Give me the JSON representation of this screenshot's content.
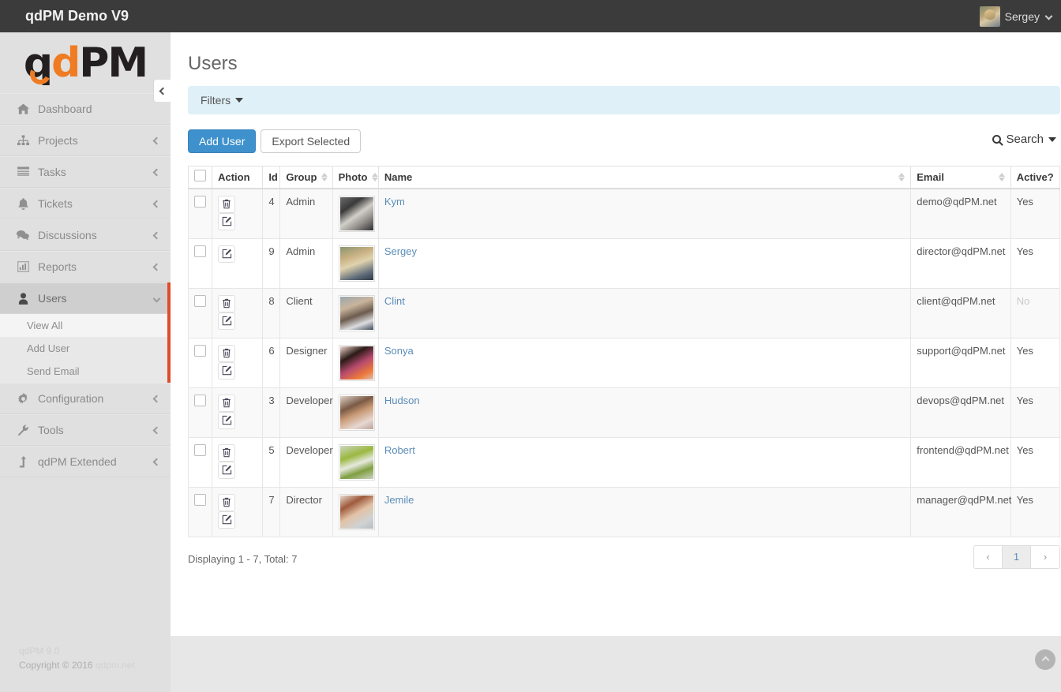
{
  "topbar": {
    "brand": "qdPM Demo V9",
    "user": {
      "name": "Sergey",
      "avatar_icon": "user-avatar-photo",
      "caret_icon": "chevron-down-icon"
    }
  },
  "sidebar": {
    "logo": {
      "q": "q",
      "d": "d",
      "pm": "PM"
    },
    "toggle_icon": "chevron-left-icon",
    "items": [
      {
        "label": "Dashboard",
        "icon": "home-icon",
        "arrow": "",
        "active": false
      },
      {
        "label": "Projects",
        "icon": "sitemap-icon",
        "arrow": "chevron-left-icon",
        "active": false
      },
      {
        "label": "Tasks",
        "icon": "tasks-icon",
        "arrow": "chevron-left-icon",
        "active": false
      },
      {
        "label": "Tickets",
        "icon": "bell-icon",
        "arrow": "chevron-left-icon",
        "active": false
      },
      {
        "label": "Discussions",
        "icon": "comments-icon",
        "arrow": "chevron-left-icon",
        "active": false
      },
      {
        "label": "Reports",
        "icon": "bar-chart-icon",
        "arrow": "chevron-left-icon",
        "active": false
      },
      {
        "label": "Users",
        "icon": "user-icon",
        "arrow": "chevron-down-icon",
        "active": true
      },
      {
        "label": "Configuration",
        "icon": "gear-icon",
        "arrow": "chevron-left-icon",
        "active": false
      },
      {
        "label": "Tools",
        "icon": "wrench-icon",
        "arrow": "chevron-left-icon",
        "active": false
      },
      {
        "label": "qdPM Extended",
        "icon": "level-up-icon",
        "arrow": "chevron-left-icon",
        "active": false
      }
    ],
    "submenu": [
      {
        "label": "View All",
        "current": true
      },
      {
        "label": "Add User",
        "current": false
      },
      {
        "label": "Send Email",
        "current": false
      }
    ]
  },
  "footer": {
    "version": "qdPM 9.0",
    "copyright_prefix": "Copyright © 2016 ",
    "copyright_link": "qdpm.net"
  },
  "main": {
    "page_title": "Users",
    "filters": {
      "label": "Filters",
      "caret_icon": "caret-down-icon"
    },
    "toolbar": {
      "add_user_label": "Add User",
      "export_label": "Export Selected",
      "search_label": "Search",
      "search_icon": "search-icon",
      "search_caret_icon": "caret-down-icon"
    },
    "table": {
      "headers": [
        {
          "key": "cb",
          "label": "",
          "sortable": false
        },
        {
          "key": "act",
          "label": "Action",
          "sortable": false
        },
        {
          "key": "id",
          "label": "Id",
          "sortable": false
        },
        {
          "key": "group",
          "label": "Group",
          "sortable": true
        },
        {
          "key": "photo",
          "label": "Photo",
          "sortable": true
        },
        {
          "key": "name",
          "label": "Name",
          "sortable": true
        },
        {
          "key": "email",
          "label": "Email",
          "sortable": true
        },
        {
          "key": "active",
          "label": "Active?",
          "sortable": false
        }
      ],
      "rows": [
        {
          "id": "4",
          "group": "Admin",
          "name": "Kym",
          "email": "demo@qdPM.net",
          "active": "Yes",
          "can_delete": true,
          "photo": "ph-kym"
        },
        {
          "id": "9",
          "group": "Admin",
          "name": "Sergey",
          "email": "director@qdPM.net",
          "active": "Yes",
          "can_delete": false,
          "photo": "ph-sergey"
        },
        {
          "id": "8",
          "group": "Client",
          "name": "Clint",
          "email": "client@qdPM.net",
          "active": "No",
          "can_delete": true,
          "photo": "ph-clint"
        },
        {
          "id": "6",
          "group": "Designer",
          "name": "Sonya",
          "email": "support@qdPM.net",
          "active": "Yes",
          "can_delete": true,
          "photo": "ph-sonya"
        },
        {
          "id": "3",
          "group": "Developer",
          "name": "Hudson",
          "email": "devops@qdPM.net",
          "active": "Yes",
          "can_delete": true,
          "photo": "ph-hudson"
        },
        {
          "id": "5",
          "group": "Developer",
          "name": "Robert",
          "email": "frontend@qdPM.net",
          "active": "Yes",
          "can_delete": true,
          "photo": "ph-robert"
        },
        {
          "id": "7",
          "group": "Director",
          "name": "Jemile",
          "email": "manager@qdPM.net",
          "active": "Yes",
          "can_delete": true,
          "photo": "ph-jemile"
        }
      ],
      "row_action_icons": {
        "delete": "trash-icon",
        "edit": "pencil-square-icon"
      },
      "select_all_icon": "checkbox-unchecked-icon"
    },
    "displaying": "Displaying 1 - 7, Total: 7",
    "pager": {
      "prev": "‹",
      "pages": [
        "1"
      ],
      "next": "›",
      "current": "1"
    },
    "scroll_top_icon": "chevron-up-icon"
  },
  "colors": {
    "navbar_bg": "#3b3b3b",
    "sidebar_bg": "#e0e0e0",
    "active_accent": "#e04b2a",
    "primary_button": "#3f91cd",
    "filters_bg": "#dff0f8",
    "link": "#5b8db8",
    "logo_orange": "#ef7b22"
  }
}
